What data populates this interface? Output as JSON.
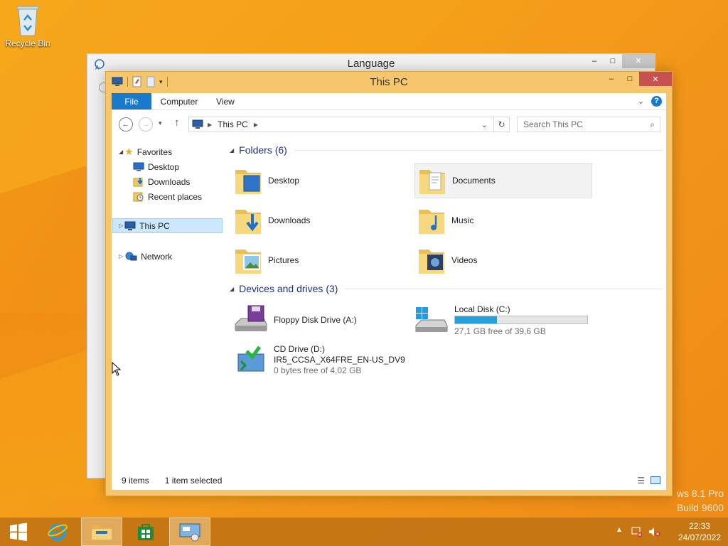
{
  "desktop": {
    "recycle_bin_label": "Recycle Bin",
    "watermark_line1": "ws 8.1 Pro",
    "watermark_line2": "Build 9600"
  },
  "language_window": {
    "title": "Language"
  },
  "explorer": {
    "title": "This PC",
    "ribbon_tabs": [
      "File",
      "Computer",
      "View"
    ],
    "address_crumb": "This PC",
    "search_placeholder": "Search This PC",
    "nav": {
      "favorites": "Favorites",
      "favorites_items": [
        "Desktop",
        "Downloads",
        "Recent places"
      ],
      "this_pc": "This PC",
      "network": "Network"
    },
    "folders_header": "Folders (6)",
    "folders": [
      "Desktop",
      "Documents",
      "Downloads",
      "Music",
      "Pictures",
      "Videos"
    ],
    "devices_header": "Devices and drives (3)",
    "drives": {
      "floppy": {
        "name": "Floppy Disk Drive (A:)"
      },
      "local": {
        "name": "Local Disk (C:)",
        "free": "27,1 GB free of 39,6 GB",
        "used_fraction": 0.316
      },
      "cd": {
        "name": "CD Drive (D:)",
        "label": "IR5_CCSA_X64FRE_EN-US_DV9",
        "free": "0 bytes free of 4,02 GB"
      }
    },
    "status_items": "9 items",
    "status_selected": "1 item selected"
  },
  "taskbar": {
    "time": "22:33",
    "date": "24/07/2022"
  }
}
